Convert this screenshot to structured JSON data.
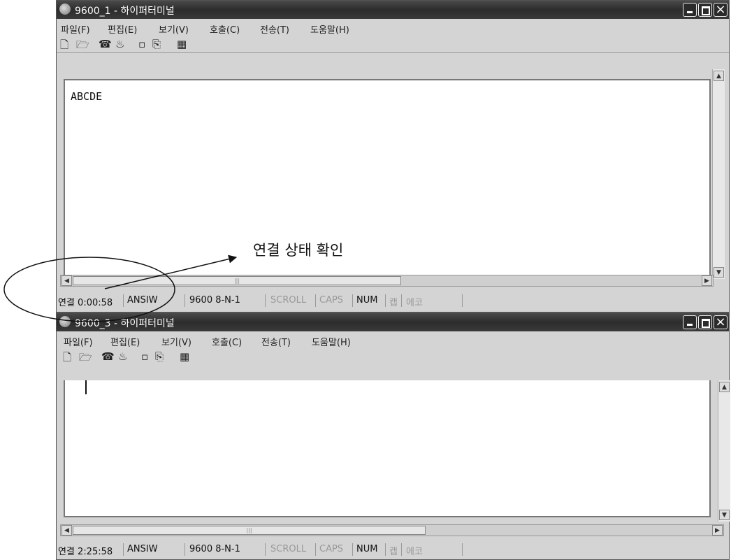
{
  "window1": {
    "title": "9600_1 - 하이퍼터미널",
    "menu": [
      "파일(F)",
      "편집(E)",
      "보기(V)",
      "호출(C)",
      "전송(T)",
      "도움말(H)"
    ],
    "terminal_text": "ABCDE",
    "status": {
      "connection": "연결 0:00:58",
      "emulation": "ANSIW",
      "port": "9600 8-N-1",
      "scroll": "SCROLL",
      "caps": "CAPS",
      "num": "NUM",
      "capture": "캡",
      "echo": "에코"
    }
  },
  "window2": {
    "title": "9600_3 - 하이퍼터미널",
    "menu": [
      "파일(F)",
      "편집(E)",
      "보기(V)",
      "호출(C)",
      "전송(T)",
      "도움말(H)"
    ],
    "terminal_text": "",
    "status": {
      "connection": "연결 2:25:58",
      "emulation": "ANSIW",
      "port": "9600 8-N-1",
      "scroll": "SCROLL",
      "caps": "CAPS",
      "num": "NUM",
      "capture": "캡",
      "echo": "에코"
    }
  },
  "annotation": {
    "label": "연결 상태 확인"
  },
  "icons": [
    "new-icon",
    "open-icon",
    "call-icon",
    "disconnect-icon",
    "send-icon",
    "receive-icon",
    "properties-icon"
  ],
  "colors": {
    "titlebar": "#333333",
    "window": "#d4d4d4",
    "terminal": "#ffffff"
  }
}
